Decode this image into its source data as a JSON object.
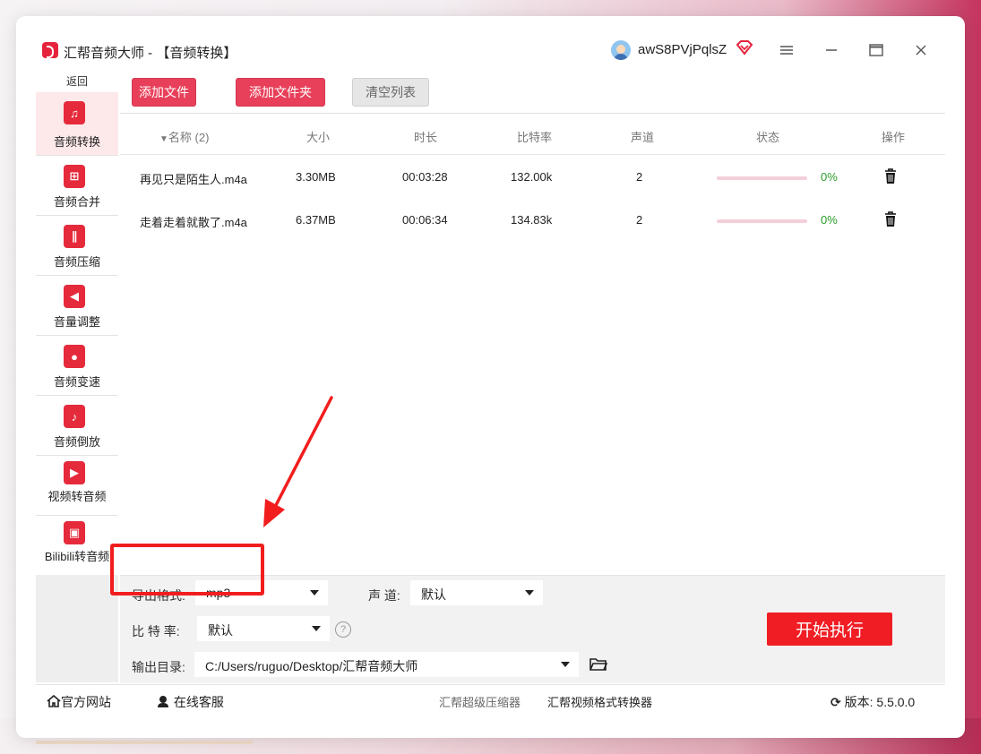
{
  "window": {
    "title": "汇帮音频大师  - 【音频转换】",
    "username": "awS8PVjPqlsZ"
  },
  "sidebar": {
    "back_label": "返回",
    "items": [
      {
        "label": "音频转换",
        "icon": "audio-convert-icon",
        "glyph": "♫",
        "active": true
      },
      {
        "label": "音频合并",
        "icon": "audio-merge-icon",
        "glyph": "⊞",
        "active": false
      },
      {
        "label": "音频压缩",
        "icon": "audio-compress-icon",
        "glyph": "∥",
        "active": false
      },
      {
        "label": "音量调整",
        "icon": "volume-adjust-icon",
        "glyph": "◀",
        "active": false
      },
      {
        "label": "音频变速",
        "icon": "audio-speed-icon",
        "glyph": "●",
        "active": false
      },
      {
        "label": "音频倒放",
        "icon": "audio-reverse-icon",
        "glyph": "♪",
        "active": false
      },
      {
        "label": "视频转音频",
        "icon": "video-to-audio-icon",
        "glyph": "▶",
        "active": false
      },
      {
        "label": "Bilibili转音频",
        "icon": "bilibili-icon",
        "glyph": "▣",
        "active": false
      }
    ]
  },
  "toolbar": {
    "add_file": "添加文件",
    "add_folder": "添加文件夹",
    "clear_list": "清空列表"
  },
  "table": {
    "headers": {
      "name": "名称 (2)",
      "size": "大小",
      "duration": "时长",
      "bitrate": "比特率",
      "channels": "声道",
      "status": "状态",
      "action": "操作"
    },
    "rows": [
      {
        "name": "再见只是陌生人.m4a",
        "size": "3.30MB",
        "duration": "00:03:28",
        "bitrate": "132.00k",
        "channels": "2",
        "progress": "0%"
      },
      {
        "name": "走着走着就散了.m4a",
        "size": "6.37MB",
        "duration": "00:06:34",
        "bitrate": "134.83k",
        "channels": "2",
        "progress": "0%"
      }
    ]
  },
  "settings": {
    "format_label": "导出格式:",
    "format_value": "mp3",
    "channel_label": "声 道:",
    "channel_value": "默认",
    "bitrate_label": "比 特 率:",
    "bitrate_value": "默认",
    "output_label": "输出目录:",
    "output_value": "C:/Users/ruguo/Desktop/汇帮音频大师",
    "help_glyph": "?",
    "start_button": "开始执行"
  },
  "footer": {
    "website": "官方网站",
    "support": "在线客服",
    "link1": "汇帮超级压缩器",
    "link2": "汇帮视频格式转换器",
    "version": "版本: 5.5.0.0"
  },
  "colors": {
    "accent": "#e8405a",
    "start": "#f01d24",
    "progress_text": "#2a9d2a",
    "annotation": "#f21d1d"
  }
}
